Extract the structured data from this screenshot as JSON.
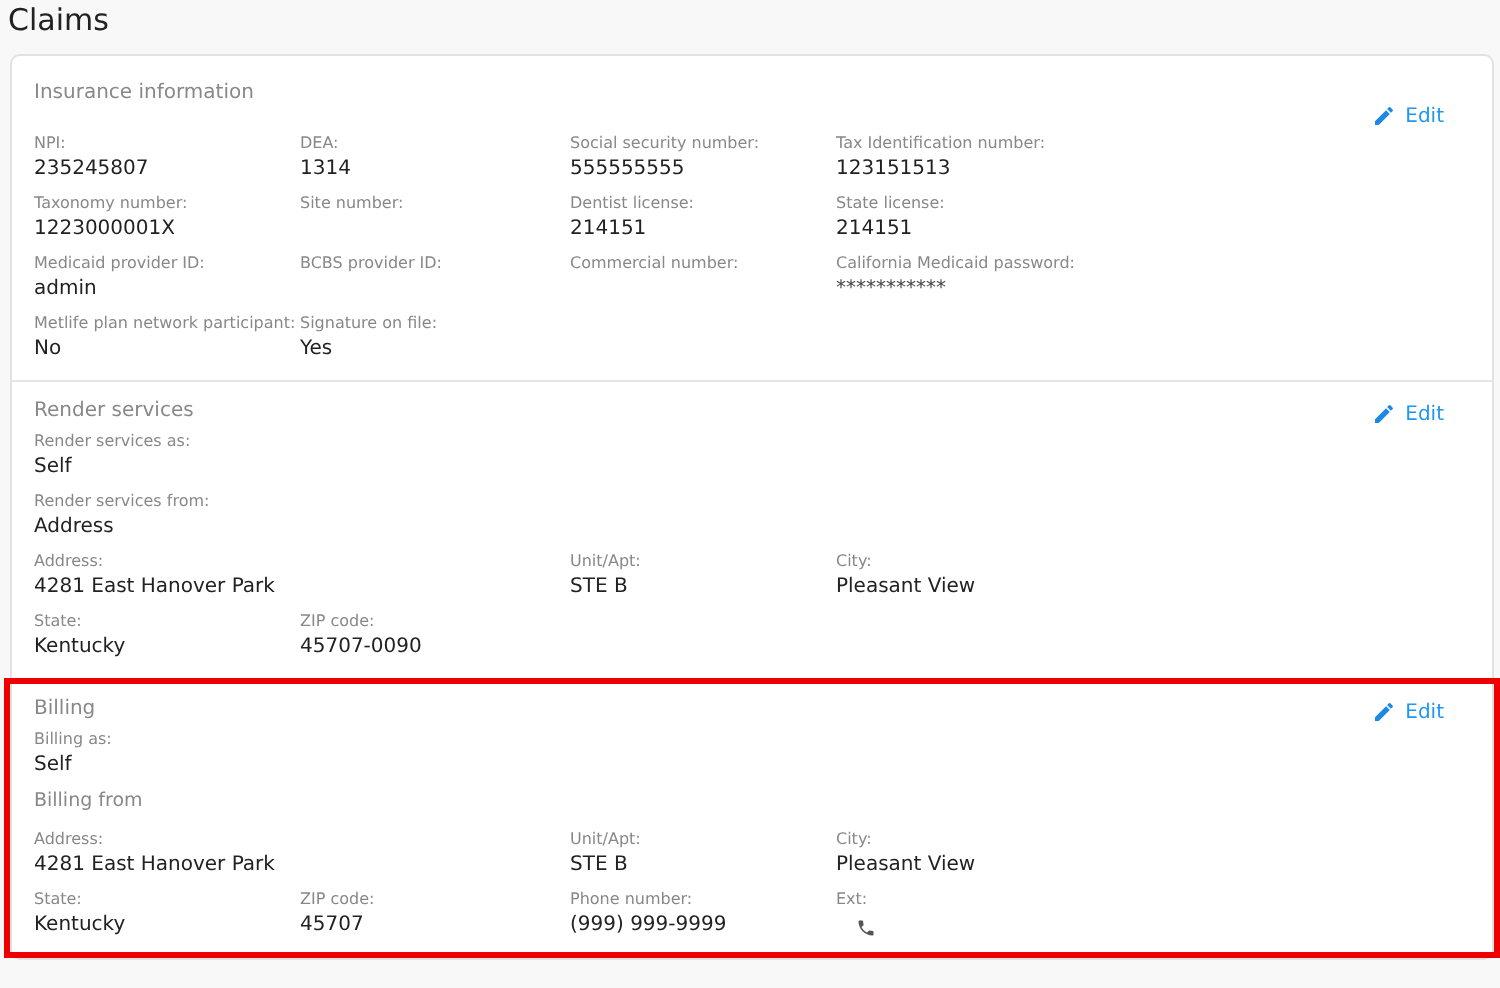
{
  "page": {
    "title": "Claims"
  },
  "sections": [
    {
      "title": "Insurance information",
      "edit": "Edit",
      "highlighted": false,
      "rows": [
        {
          "fields": [
            {
              "label": "NPI:",
              "value": "235245807"
            },
            {
              "label": "DEA:",
              "value": "1314"
            },
            {
              "label": "Social security number:",
              "value": "555555555"
            },
            {
              "label": "Tax Identification number:",
              "value": "123151513"
            }
          ]
        },
        {
          "fields": [
            {
              "label": "Taxonomy number:",
              "value": "1223000001X"
            },
            {
              "label": "Site number:"
            },
            {
              "label": "Dentist license:",
              "value": "214151"
            },
            {
              "label": "State license:",
              "value": "214151"
            }
          ]
        },
        {
          "fields": [
            {
              "label": "Medicaid provider ID:",
              "value": "admin"
            },
            {
              "label": "BCBS provider ID:"
            },
            {
              "label": "Commercial number:"
            },
            {
              "label": "California Medicaid password:",
              "value": "***********",
              "kind": "masked"
            }
          ]
        },
        {
          "fields": [
            {
              "label": "Metlife plan network participant:",
              "value": "No"
            },
            {
              "label": "Signature on file:",
              "value": "Yes"
            }
          ]
        }
      ]
    },
    {
      "title": "Render services",
      "edit": "Edit",
      "highlighted": false,
      "rows": [
        {
          "fields": [
            {
              "label": "Render services as:",
              "value": "Self"
            }
          ]
        },
        {
          "fields": [
            {
              "label": "Render services from:",
              "value": "Address"
            }
          ]
        },
        {
          "fields": [
            {
              "label": "Address:",
              "value": "4281 East Hanover Park"
            },
            {
              "label": "Unit/Apt:",
              "value": "STE B"
            },
            {
              "label": "City:",
              "value": "Pleasant View"
            }
          ]
        },
        {
          "fields": [
            {
              "label": "State:",
              "value": "Kentucky"
            },
            {
              "label": "ZIP code:",
              "value": "45707-0090"
            }
          ]
        }
      ]
    },
    {
      "title": "Billing",
      "edit": "Edit",
      "highlighted": true,
      "rows": [
        {
          "fields": [
            {
              "label": "Billing as:",
              "value": "Self"
            }
          ]
        },
        {
          "subheading": "Billing from"
        },
        {
          "fields": [
            {
              "label": "Address:",
              "value": "4281 East Hanover Park"
            },
            {
              "label": "Unit/Apt:",
              "value": "STE B"
            },
            {
              "label": "City:",
              "value": "Pleasant View"
            }
          ]
        },
        {
          "fields": [
            {
              "label": "State:",
              "value": "Kentucky"
            },
            {
              "label": "ZIP code:",
              "value": "45707"
            },
            {
              "label": "Phone number:",
              "value": "(999) 999-9999"
            },
            {
              "label": "Ext:",
              "kind": "phone"
            }
          ]
        }
      ]
    }
  ]
}
